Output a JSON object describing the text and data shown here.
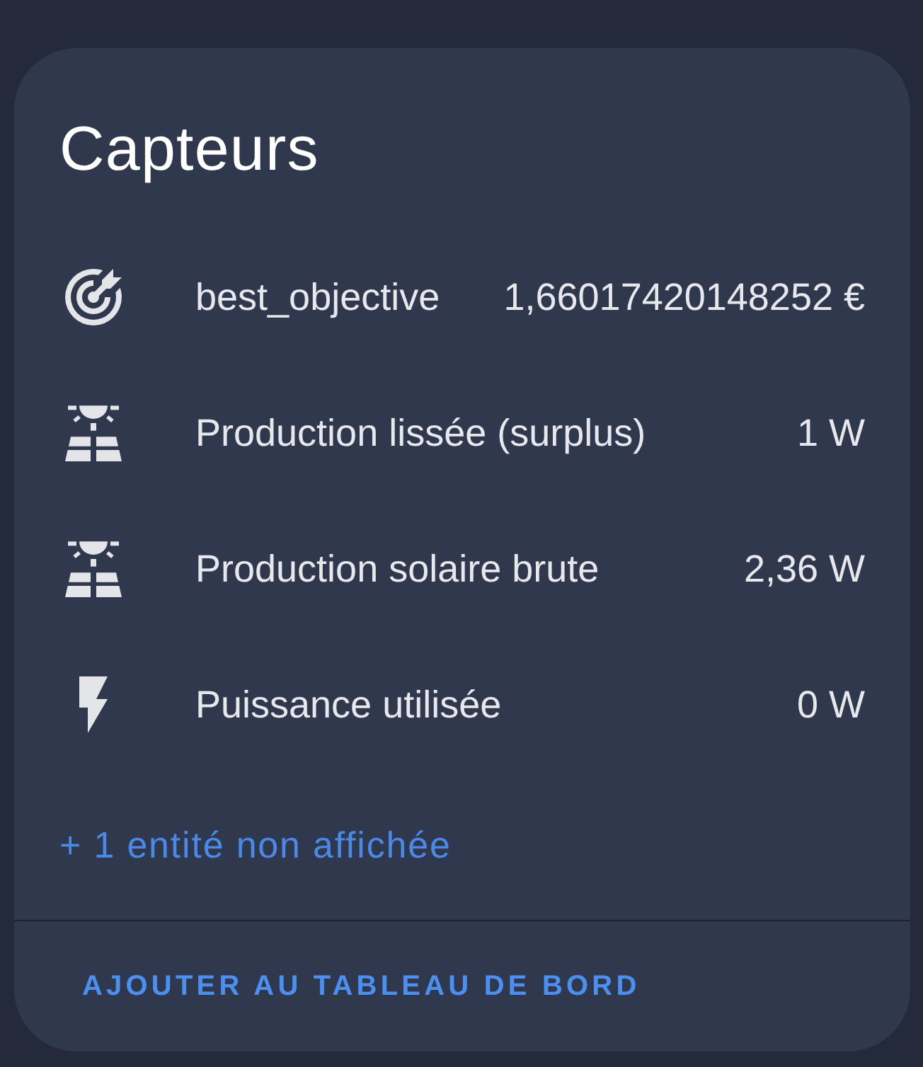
{
  "card": {
    "title": "Capteurs"
  },
  "entities": [
    {
      "kind": "target",
      "name": "best_objective",
      "state": "1,66017420148252 €"
    },
    {
      "kind": "solar",
      "name": "Production lissée (surplus)",
      "state": "1 W"
    },
    {
      "kind": "solar",
      "name": "Production solaire brute",
      "state": "2,36 W"
    },
    {
      "kind": "power",
      "name": "Puissance utilisée",
      "state": "0 W"
    }
  ],
  "more_link": "+ 1 entité non affichée",
  "actions": [
    {
      "label": "AJOUTER AU TABLEAU DE BORD"
    }
  ]
}
